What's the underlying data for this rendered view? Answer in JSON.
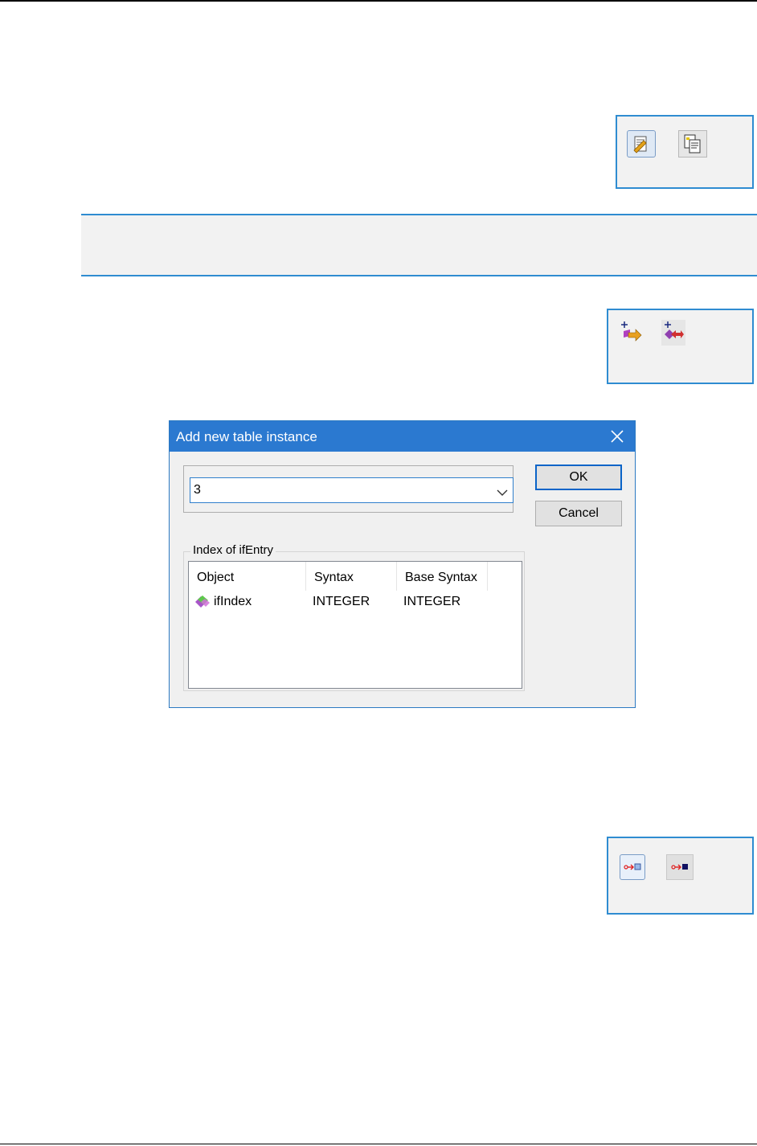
{
  "toolbar_groups": [
    {
      "icons": [
        "edit-properties-icon",
        "copy-properties-icon"
      ]
    },
    {
      "icons": [
        "add-instance-icon",
        "add-row-instance-icon"
      ]
    },
    {
      "icons": [
        "export-value-icon",
        "export-value-filled-icon"
      ]
    }
  ],
  "dialog": {
    "title": "Add new table instance",
    "combo_value": "3",
    "ok_label": "OK",
    "cancel_label": "Cancel",
    "group_label": "Index of ifEntry",
    "columns": [
      "Object",
      "Syntax",
      "Base Syntax"
    ],
    "rows": [
      {
        "object": "ifIndex",
        "syntax": "INTEGER",
        "base_syntax": "INTEGER",
        "icon": "mib-object-icon"
      }
    ]
  },
  "colors": {
    "accent_border": "#2f8cd1",
    "titlebar": "#2b79d0",
    "box_bg": "#f2f2f2"
  }
}
